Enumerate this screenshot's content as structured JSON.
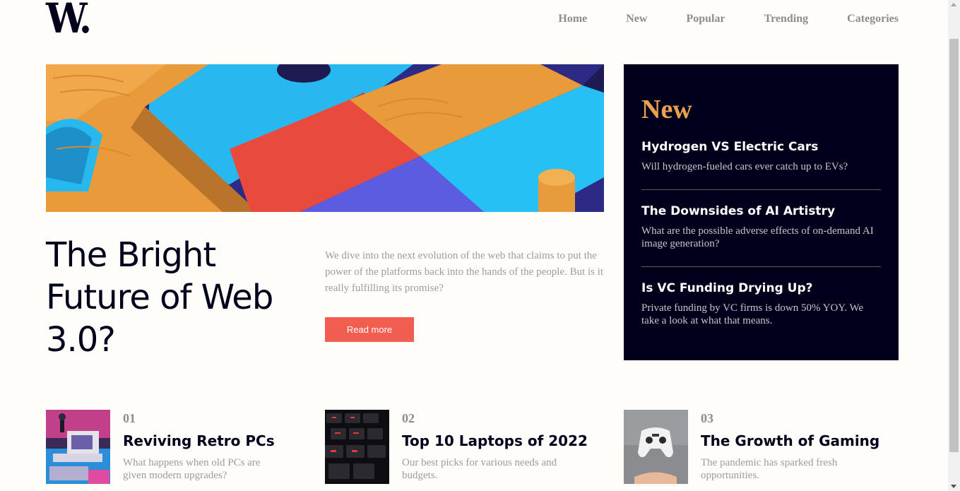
{
  "header": {
    "logo": "W.",
    "nav": [
      "Home",
      "New",
      "Popular",
      "Trending",
      "Categories"
    ]
  },
  "hero": {
    "image": "abstract-colorful-blocks-image",
    "title": "The Bright Future of Web 3.0?",
    "description": "We dive into the next evolution of the web that claims to put the power of the platforms back into the hands of the people. But is it really fulfilling its promise?",
    "button": "Read more"
  },
  "new_panel": {
    "heading": "New",
    "items": [
      {
        "title": "Hydrogen VS Electric Cars",
        "description": "Will hydrogen-fueled cars ever catch up to EVs?"
      },
      {
        "title": "The Downsides of AI Artistry",
        "description": "What are the possible adverse effects of on-demand AI image generation?"
      },
      {
        "title": "Is VC Funding Drying Up?",
        "description": "Private funding by VC firms is down 50% YOY. We take a look at what that means."
      }
    ]
  },
  "cards": [
    {
      "number": "01",
      "title": "Reviving Retro PCs",
      "description": "What happens when old PCs are given modern upgrades?",
      "image": "retro-pc-image"
    },
    {
      "number": "02",
      "title": "Top 10 Laptops of 2022",
      "description": "Our best picks for various needs and budgets.",
      "image": "laptop-keyboard-image"
    },
    {
      "number": "03",
      "title": "The Growth of Gaming",
      "description": "The pandemic has sparked fresh opportunities.",
      "image": "game-controller-image"
    }
  ],
  "colors": {
    "accent": "#f15e50",
    "panel_bg": "#00001a",
    "new_heading": "#e9a150",
    "text_dark": "#00001a",
    "text_muted": "#9c9c9c"
  }
}
